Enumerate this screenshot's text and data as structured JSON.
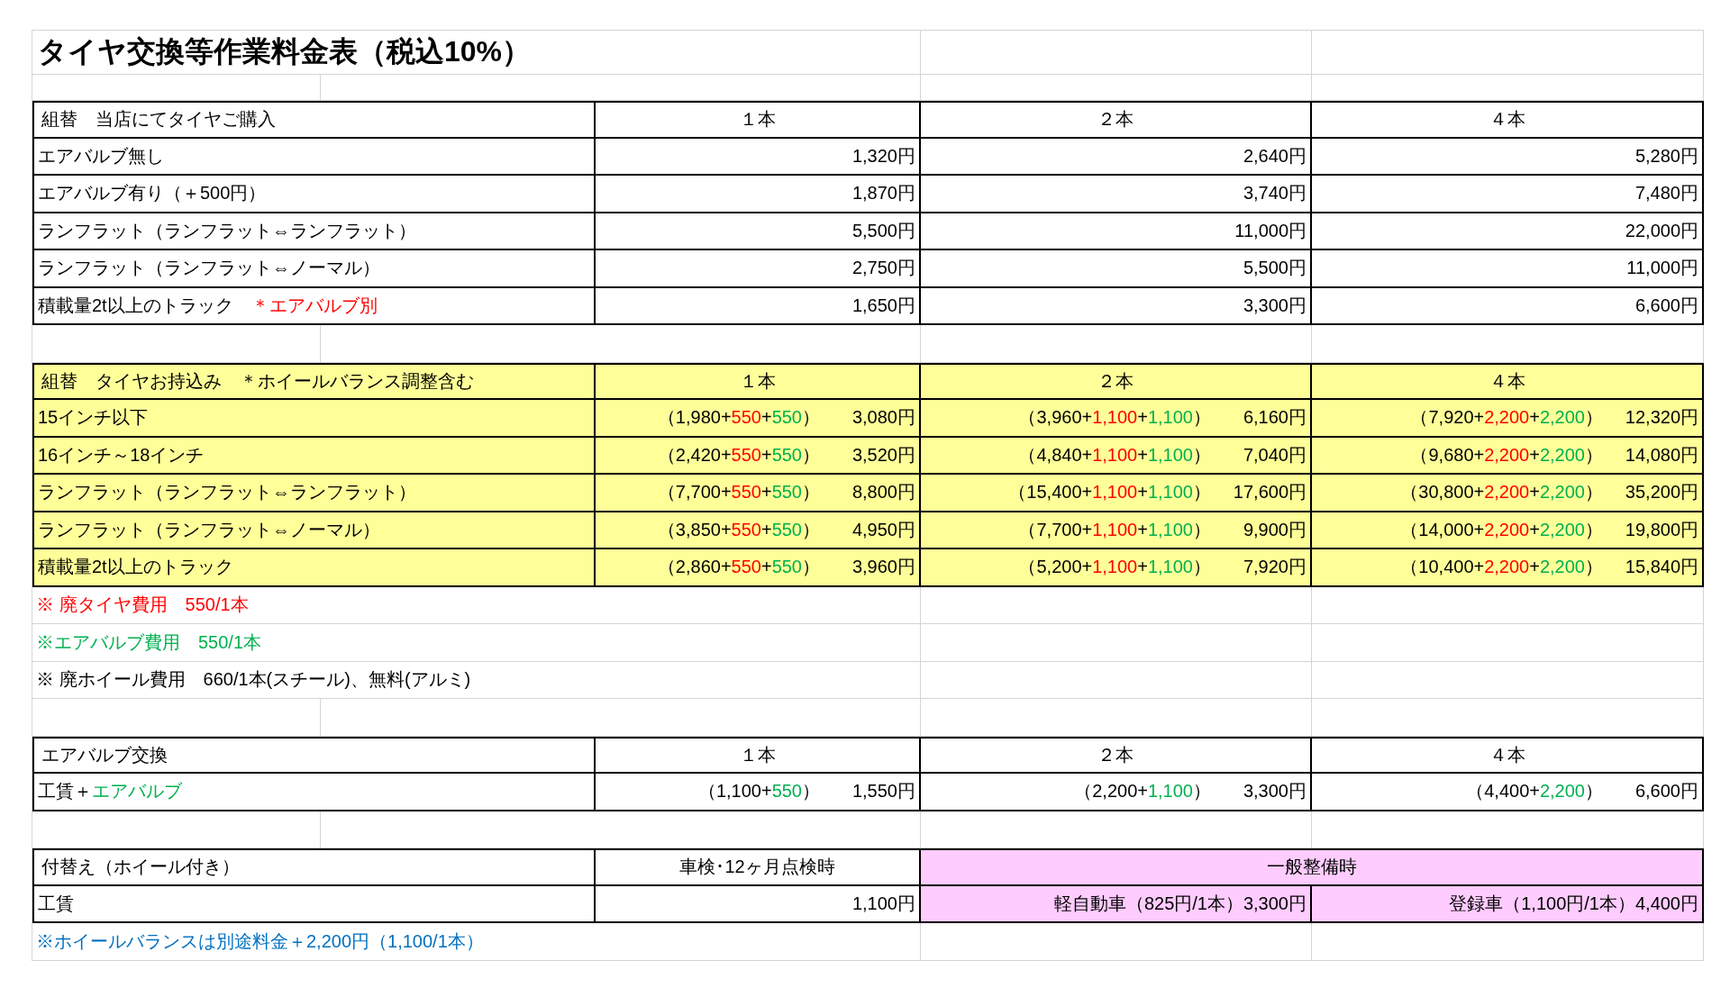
{
  "title": "タイヤ交換等作業料金表（税込10%）",
  "sections": [
    {
      "header": {
        "label": "組替　当店にてタイヤご購入",
        "columns": [
          {
            "text": "１本"
          },
          {
            "text": "２本"
          },
          {
            "text": "４本"
          }
        ]
      },
      "rows": [
        {
          "label": [
            {
              "text": "エアバルブ無し"
            }
          ],
          "cells": [
            {
              "total": "1,320円"
            },
            {
              "total": "2,640円"
            },
            {
              "total": "5,280円"
            }
          ]
        },
        {
          "label": [
            {
              "text": "エアバルブ有り（＋500円）"
            }
          ],
          "cells": [
            {
              "total": "1,870円"
            },
            {
              "total": "3,740円"
            },
            {
              "total": "7,480円"
            }
          ]
        },
        {
          "label": [
            {
              "text": "ランフラット（ランフラット⇔ランフラット）"
            }
          ],
          "cells": [
            {
              "total": "5,500円"
            },
            {
              "total": "11,000円"
            },
            {
              "total": "22,000円"
            }
          ]
        },
        {
          "label": [
            {
              "text": "ランフラット（ランフラット⇔ノーマル）"
            }
          ],
          "cells": [
            {
              "total": "2,750円"
            },
            {
              "total": "5,500円"
            },
            {
              "total": "11,000円"
            }
          ]
        },
        {
          "label": [
            {
              "text": "積載量2t以上のトラック　"
            },
            {
              "text": "＊エアバルブ別",
              "color": "#ff0000"
            }
          ],
          "cells": [
            {
              "total": "1,650円"
            },
            {
              "total": "3,300円"
            },
            {
              "total": "6,600円"
            }
          ]
        }
      ]
    },
    {
      "color": "#ffff99",
      "header": {
        "label": "組替　タイヤお持込み　＊ホイールバランス調整含む",
        "columns": [
          {
            "text": "１本"
          },
          {
            "text": "２本"
          },
          {
            "text": "４本"
          }
        ]
      },
      "rows": [
        {
          "label": [
            {
              "text": "15インチ以下"
            }
          ],
          "cells": [
            {
              "breakdown": [
                {
                  "text": "（1,980+"
                },
                {
                  "text": "550",
                  "color": "#ff0000"
                },
                {
                  "text": "+"
                },
                {
                  "text": "550",
                  "color": "#00b050"
                },
                {
                  "text": "）"
                }
              ],
              "total": "3,080円"
            },
            {
              "breakdown": [
                {
                  "text": "（3,960+"
                },
                {
                  "text": "1,100",
                  "color": "#ff0000"
                },
                {
                  "text": "+"
                },
                {
                  "text": "1,100",
                  "color": "#00b050"
                },
                {
                  "text": "）"
                }
              ],
              "total": "6,160円"
            },
            {
              "breakdown": [
                {
                  "text": "（7,920+"
                },
                {
                  "text": "2,200",
                  "color": "#ff0000"
                },
                {
                  "text": "+"
                },
                {
                  "text": "2,200",
                  "color": "#00b050"
                },
                {
                  "text": "）"
                }
              ],
              "total": "12,320円"
            }
          ]
        },
        {
          "label": [
            {
              "text": "16インチ～18インチ"
            }
          ],
          "cells": [
            {
              "breakdown": [
                {
                  "text": "（2,420+"
                },
                {
                  "text": "550",
                  "color": "#ff0000"
                },
                {
                  "text": "+"
                },
                {
                  "text": "550",
                  "color": "#00b050"
                },
                {
                  "text": "）"
                }
              ],
              "total": "3,520円"
            },
            {
              "breakdown": [
                {
                  "text": "（4,840+"
                },
                {
                  "text": "1,100",
                  "color": "#ff0000"
                },
                {
                  "text": "+"
                },
                {
                  "text": "1,100",
                  "color": "#00b050"
                },
                {
                  "text": "）"
                }
              ],
              "total": "7,040円"
            },
            {
              "breakdown": [
                {
                  "text": "（9,680+"
                },
                {
                  "text": "2,200",
                  "color": "#ff0000"
                },
                {
                  "text": "+"
                },
                {
                  "text": "2,200",
                  "color": "#00b050"
                },
                {
                  "text": "）"
                }
              ],
              "total": "14,080円"
            }
          ]
        },
        {
          "label": [
            {
              "text": "ランフラット（ランフラット⇔ランフラット）"
            }
          ],
          "cells": [
            {
              "breakdown": [
                {
                  "text": "（7,700+"
                },
                {
                  "text": "550",
                  "color": "#ff0000"
                },
                {
                  "text": "+"
                },
                {
                  "text": "550",
                  "color": "#00b050"
                },
                {
                  "text": "）"
                }
              ],
              "total": "8,800円"
            },
            {
              "breakdown": [
                {
                  "text": "（15,400+"
                },
                {
                  "text": "1,100",
                  "color": "#ff0000"
                },
                {
                  "text": "+"
                },
                {
                  "text": "1,100",
                  "color": "#00b050"
                },
                {
                  "text": "）"
                }
              ],
              "total": "17,600円"
            },
            {
              "breakdown": [
                {
                  "text": "（30,800+"
                },
                {
                  "text": "2,200",
                  "color": "#ff0000"
                },
                {
                  "text": "+"
                },
                {
                  "text": "2,200",
                  "color": "#00b050"
                },
                {
                  "text": "）"
                }
              ],
              "total": "35,200円"
            }
          ]
        },
        {
          "label": [
            {
              "text": "ランフラット（ランフラット⇔ノーマル）"
            }
          ],
          "cells": [
            {
              "breakdown": [
                {
                  "text": "（3,850+"
                },
                {
                  "text": "550",
                  "color": "#ff0000"
                },
                {
                  "text": "+"
                },
                {
                  "text": "550",
                  "color": "#00b050"
                },
                {
                  "text": "）"
                }
              ],
              "total": "4,950円"
            },
            {
              "breakdown": [
                {
                  "text": "（7,700+"
                },
                {
                  "text": "1,100",
                  "color": "#ff0000"
                },
                {
                  "text": "+"
                },
                {
                  "text": "1,100",
                  "color": "#00b050"
                },
                {
                  "text": "）"
                }
              ],
              "total": "9,900円"
            },
            {
              "breakdown": [
                {
                  "text": "（14,000+"
                },
                {
                  "text": "2,200",
                  "color": "#ff0000"
                },
                {
                  "text": "+"
                },
                {
                  "text": "2,200",
                  "color": "#00b050"
                },
                {
                  "text": "）"
                }
              ],
              "total": "19,800円"
            }
          ]
        },
        {
          "label": [
            {
              "text": "積載量2t以上のトラック"
            }
          ],
          "cells": [
            {
              "breakdown": [
                {
                  "text": "（2,860+"
                },
                {
                  "text": "550",
                  "color": "#ff0000"
                },
                {
                  "text": "+"
                },
                {
                  "text": "550",
                  "color": "#00b050"
                },
                {
                  "text": "）"
                }
              ],
              "total": "3,960円"
            },
            {
              "breakdown": [
                {
                  "text": "（5,200+"
                },
                {
                  "text": "1,100",
                  "color": "#ff0000"
                },
                {
                  "text": "+"
                },
                {
                  "text": "1,100",
                  "color": "#00b050"
                },
                {
                  "text": "）"
                }
              ],
              "total": "7,920円"
            },
            {
              "breakdown": [
                {
                  "text": "（10,400+"
                },
                {
                  "text": "2,200",
                  "color": "#ff0000"
                },
                {
                  "text": "+"
                },
                {
                  "text": "2,200",
                  "color": "#00b050"
                },
                {
                  "text": "）"
                }
              ],
              "total": "15,840円"
            }
          ]
        }
      ],
      "notes": [
        {
          "text": "※ 廃タイヤ費用　550/1本",
          "color": "#ff0000"
        },
        {
          "text": "※エアバルブ費用　550/1本",
          "color": "#00b050"
        },
        {
          "text": "※ 廃ホイール費用　660/1本(スチール)、無料(アルミ)",
          "color": "#000000"
        }
      ]
    },
    {
      "header": {
        "label": "エアバルブ交換",
        "columns": [
          {
            "text": "１本"
          },
          {
            "text": "２本"
          },
          {
            "text": "４本"
          }
        ]
      },
      "rows": [
        {
          "label": [
            {
              "text": "工賃＋"
            },
            {
              "text": "エアバルブ",
              "color": "#00b050"
            }
          ],
          "cells": [
            {
              "breakdown": [
                {
                  "text": "（1,100+"
                },
                {
                  "text": "550",
                  "color": "#00b050"
                },
                {
                  "text": "）"
                }
              ],
              "total": "1,550円"
            },
            {
              "breakdown": [
                {
                  "text": "（2,200+"
                },
                {
                  "text": "1,100",
                  "color": "#00b050"
                },
                {
                  "text": "）"
                }
              ],
              "total": "3,300円"
            },
            {
              "breakdown": [
                {
                  "text": "（4,400+"
                },
                {
                  "text": "2,200",
                  "color": "#00b050"
                },
                {
                  "text": "）"
                }
              ],
              "total": "6,600円"
            }
          ]
        }
      ]
    },
    {
      "header": {
        "label": "付替え（ホイール付き）",
        "columns": [
          {
            "text": "車検･12ヶ月点検時"
          },
          {
            "text": "一般整備時",
            "wide": true,
            "color": "#ffccff"
          }
        ]
      },
      "rows": [
        {
          "label": [
            {
              "text": "工賃"
            }
          ],
          "cells": [
            {
              "total": "1,100円"
            },
            {
              "total": "軽自動車（825円/1本）3,300円",
              "color": "#ffccff"
            },
            {
              "total": "登録車（1,100円/1本）4,400円",
              "color": "#ffccff"
            }
          ]
        }
      ],
      "notes": [
        {
          "text": "※ホイールバランスは別途料金＋2,200円（1,100/1本）",
          "color": "#0070c0"
        }
      ]
    }
  ]
}
